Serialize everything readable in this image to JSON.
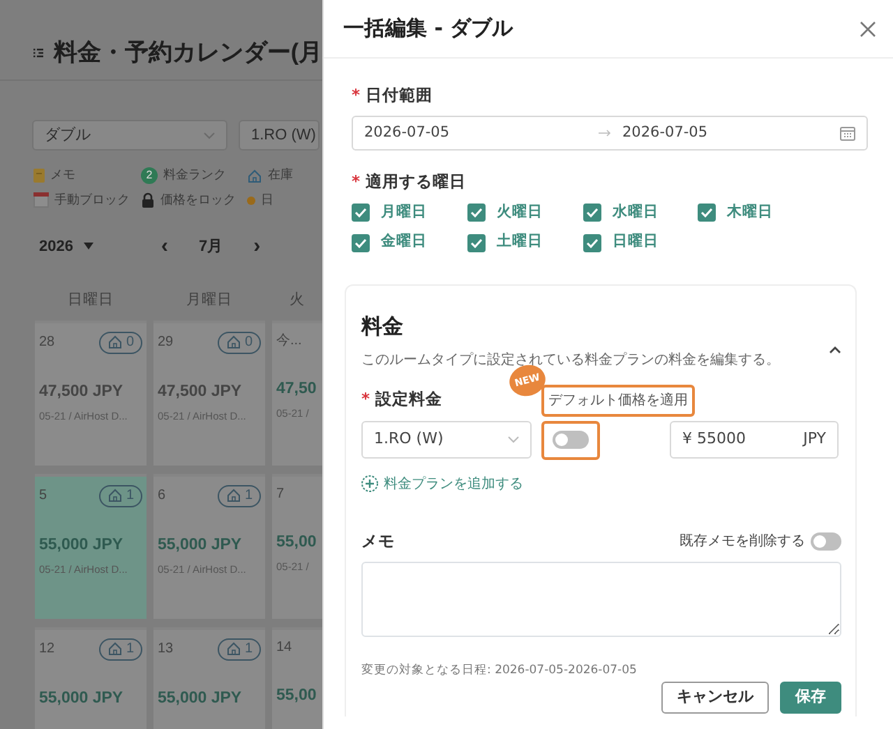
{
  "background": {
    "title": "料金・予約カレンダー(月",
    "room_select": "ダブル",
    "plan_select": "1.RO (W)",
    "legend": [
      {
        "kind": "memo",
        "label": "メモ"
      },
      {
        "kind": "rank",
        "label": "料金ランク",
        "icon_text": "2"
      },
      {
        "kind": "stock",
        "label": "在庫"
      },
      {
        "kind": "block",
        "label": "手動ブロック"
      },
      {
        "kind": "lock",
        "label": "価格をロック"
      },
      {
        "kind": "dot",
        "label": "日"
      }
    ],
    "year": "2026",
    "prev": "‹",
    "month": "7月",
    "next": "›",
    "weekdays": [
      "日曜日",
      "月曜日",
      "火"
    ],
    "weeks": [
      [
        {
          "day": "28",
          "stock": "0",
          "price": "47,500 JPY",
          "note": "05-21 / AirHost D...",
          "color": "#454545",
          "selected": false
        },
        {
          "day": "29",
          "stock": "0",
          "price": "47,500 JPY",
          "note": "05-21 / AirHost D...",
          "color": "#454545",
          "selected": false
        },
        {
          "day": "今...",
          "price": "47,50",
          "note": "05-21 /",
          "color": "#2f5a50",
          "selected": false
        }
      ],
      [
        {
          "day": "5",
          "stock": "1",
          "price": "55,000 JPY",
          "note": "05-21 / AirHost D...",
          "color": "#2f5a50",
          "selected": true
        },
        {
          "day": "6",
          "stock": "1",
          "price": "55,000 JPY",
          "note": "05-21 / AirHost D...",
          "color": "#2f5a50",
          "selected": false
        },
        {
          "day": "7",
          "price": "55,00",
          "note": "05-21 /",
          "color": "#2f5a50",
          "selected": false
        }
      ],
      [
        {
          "day": "12",
          "stock": "1",
          "price": "55,000 JPY",
          "color": "#2f5a50",
          "selected": false
        },
        {
          "day": "13",
          "stock": "1",
          "price": "55,000 JPY",
          "color": "#2f5a50",
          "selected": false
        },
        {
          "day": "14",
          "price": "55,00",
          "color": "#2f5a50",
          "selected": false
        }
      ]
    ]
  },
  "drawer": {
    "title": "一括編集 - ダブル",
    "date_range": {
      "label": "日付範囲",
      "required_mark": "*",
      "start": "2026-07-05",
      "end": "2026-07-05"
    },
    "weekdays": {
      "label": "適用する曜日",
      "required_mark": "*",
      "options": [
        {
          "label": "月曜日",
          "checked": true
        },
        {
          "label": "火曜日",
          "checked": true
        },
        {
          "label": "水曜日",
          "checked": true
        },
        {
          "label": "木曜日",
          "checked": true
        },
        {
          "label": "金曜日",
          "checked": true
        },
        {
          "label": "土曜日",
          "checked": true
        },
        {
          "label": "日曜日",
          "checked": true
        }
      ]
    },
    "pricing": {
      "title": "料金",
      "expanded": true,
      "description": "このルームタイプに設定されている料金プランの料金を編集する。",
      "new_badge": "NEW",
      "rate_label": "設定料金",
      "required_mark": "*",
      "default_price_label": "デフォルト価格を適用",
      "plan_select": "1.RO (W)",
      "use_default": false,
      "currency_symbol": "¥",
      "price": "55000",
      "currency": "JPY",
      "add_plan": "料金プランを追加する"
    },
    "memo": {
      "label": "メモ",
      "delete_existing_label": "既存メモを削除する",
      "delete_existing": false
    },
    "footnote": "変更の対象となる日程: 2026-07-05-2026-07-05",
    "buttons": [
      {
        "label": "キャンセル",
        "kind": "secondary"
      },
      {
        "label": "保存",
        "kind": "primary"
      }
    ]
  }
}
